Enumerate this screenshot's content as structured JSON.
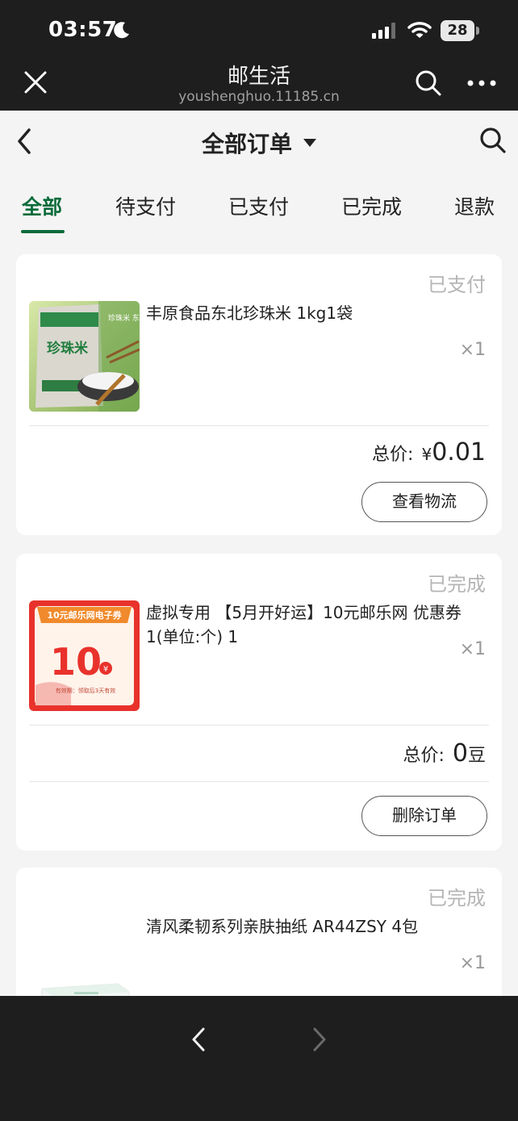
{
  "status_bar": {
    "time": "03:57",
    "battery": "28"
  },
  "browser": {
    "title": "邮生活",
    "url": "youshenghuo.11185.cn"
  },
  "nav": {
    "title": "全部订单"
  },
  "tabs": [
    "全部",
    "待支付",
    "已支付",
    "已完成",
    "退款"
  ],
  "orders": [
    {
      "status": "已支付",
      "product": "丰原食品东北珍珠米 1kg1袋",
      "qty": "×1",
      "total_label": "总价:",
      "total_currency": "¥",
      "total_value": "0.01",
      "total_suffix": "",
      "action": "查看物流",
      "thumb_text": {
        "brand": "珍珠米",
        "side": "珍珠米 东北大米"
      }
    },
    {
      "status": "已完成",
      "product": "虚拟专用 【5月开好运】10元邮乐网 优惠券 1(单位:个) 1",
      "qty": "×1",
      "total_label": "总价:",
      "total_currency": "",
      "total_value": "0",
      "total_suffix": "豆",
      "action": "删除订单",
      "thumb_text": {
        "header": "10元邮乐网电子券",
        "amount": "10",
        "yen": "¥",
        "footer": "有效期：领取后3天有效"
      }
    },
    {
      "status": "已完成",
      "product": "清风柔韧系列亲肤抽纸 AR44ZSY 4包",
      "qty": "×1"
    }
  ],
  "colors": {
    "accent": "#0b6b3a",
    "status_gray": "#b5b5b5",
    "coupon_red": "#e8322b"
  }
}
